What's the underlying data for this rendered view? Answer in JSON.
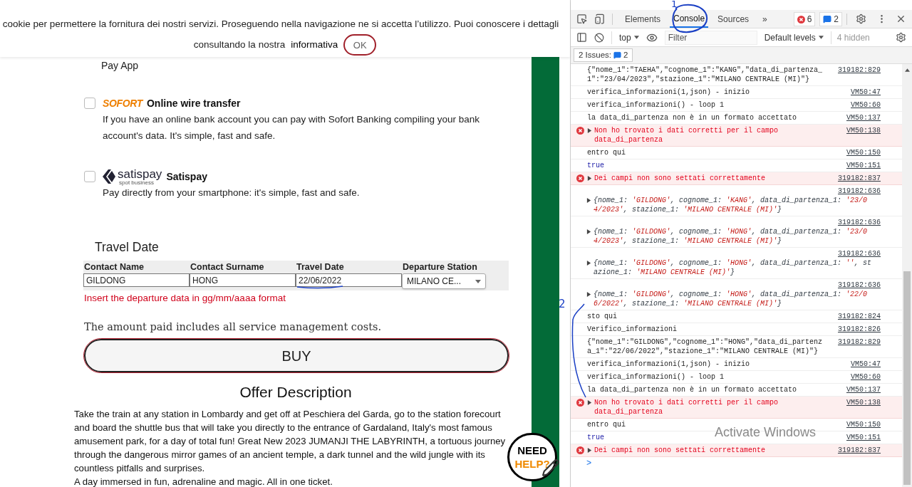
{
  "cookie_banner": {
    "text": "cookie per permettere la fornitura dei nostri servizi. Proseguendo nella navigazione ne si accetta l’utilizzo. Puoi conoscere i dettagli",
    "text_2": "consultando la nostra",
    "link": "informativa",
    "button": "OK"
  },
  "payment": {
    "continued_text": "Pay App",
    "options": [
      {
        "kind": "sofort",
        "logo": "SOFORT",
        "title": "Online wire transfer",
        "description": "If you have an online bank account you can pay with Sofort Banking compiling your bank account's data. It's simple, fast and safe.",
        "checked": false
      },
      {
        "kind": "satispay",
        "logo": "satispay",
        "logo_subtitle": "spot business",
        "title": "Satispay",
        "description": "Pay directly from your smartphone: it's simple, fast and safe.",
        "checked": false
      }
    ]
  },
  "travel_form": {
    "heading": "Travel Date",
    "fields": [
      {
        "kind": "input",
        "label": "Contact Name",
        "value": "GILDONG"
      },
      {
        "kind": "input",
        "label": "Contact Surname",
        "value": "HONG"
      },
      {
        "kind": "input",
        "label": "Travel Date",
        "value": "22/06/2022"
      },
      {
        "kind": "select",
        "label": "Departure Station",
        "value": "MILANO CE..."
      }
    ],
    "error": "Insert the departure data in gg/mm/aaaa format"
  },
  "note": "The amount paid includes all service management costs.",
  "buy_button": "BUY",
  "offer": {
    "heading": "Offer Description",
    "paragraphs": [
      "Take the train at any station in Lombardy and get off at Peschiera del Garda, go to the station forecourt and board the shuttle bus that will take you directly to the entrance of Gardaland, Italy's most famous amusement park, for a day of total fun! Great New 2023 JUMANJI THE LABYRINTH, a tortuous journey through the dangerous mirror games of an ancient temple, a dark tunnel and the wild jungle with its countless pitfalls and surprises.",
      "A day immersed in fun, adrenaline and magic. All in one ticket."
    ]
  },
  "help_badge": {
    "line_1": "NEED",
    "line_2": "HELP?"
  },
  "devtools": {
    "tabs": [
      {
        "label": "Elements",
        "selected": false
      },
      {
        "label": "Console",
        "selected": true
      },
      {
        "label": "Sources",
        "selected": false
      }
    ],
    "more_tabs": "»",
    "error_count": "6",
    "message_count": "2",
    "toolbar": {
      "context": "top",
      "filter_placeholder": "Filter",
      "levels": "Default levels",
      "hidden": "4 hidden"
    },
    "issues": {
      "label": "2 Issues:",
      "count": "2"
    },
    "messages": [
      {
        "kind": "log",
        "text": "{\"nome_1\":\"TAEHA\",\"cognome_1\":\"KANG\",\"data_di_partenza_1\":\"23/04/2023\",\"stazione_1\":\"MILANO CENTRALE (MI)\"}",
        "source": "319182:829"
      },
      {
        "kind": "log",
        "text": "verifica_informazioni(1,json) - inizio",
        "source": "VM50:47"
      },
      {
        "kind": "log",
        "text": "verifica_informazioni() - loop 1",
        "source": "VM50:60"
      },
      {
        "kind": "log",
        "text": "la data_di_partenza non è in un formato accettato",
        "source": "VM50:137"
      },
      {
        "kind": "error",
        "text": "Non ho trovato i dati corretti per il campo data_di_partenza",
        "source": "VM50:138",
        "expanded": false
      },
      {
        "kind": "log",
        "text": "entro qui",
        "source": "VM50:150"
      },
      {
        "kind": "value",
        "text": "true",
        "source": "VM50:151"
      },
      {
        "kind": "error",
        "text": "Dei campi non sono settati correttamente",
        "source": "319182:837",
        "expanded": false
      },
      {
        "kind": "object",
        "source": "319182:636",
        "expanded": false,
        "parts": [
          {
            "kind": "key",
            "text": "{nome_1: "
          },
          {
            "kind": "string",
            "text": "'GILDONG'"
          },
          {
            "kind": "key",
            "text": ", cognome_1: "
          },
          {
            "kind": "string",
            "text": "'KANG'"
          },
          {
            "kind": "key",
            "text": ", data_di_partenza_1: "
          },
          {
            "kind": "string",
            "text": "'23/04/2023'"
          },
          {
            "kind": "key",
            "text": ", stazione_1: "
          },
          {
            "kind": "string",
            "text": "'MILANO CENTRALE (MI)'"
          },
          {
            "kind": "key",
            "text": "}"
          }
        ]
      },
      {
        "kind": "object",
        "source": "319182:636",
        "expanded": false,
        "parts": [
          {
            "kind": "key",
            "text": "{nome_1: "
          },
          {
            "kind": "string",
            "text": "'GILDONG'"
          },
          {
            "kind": "key",
            "text": ", cognome_1: "
          },
          {
            "kind": "string",
            "text": "'HONG'"
          },
          {
            "kind": "key",
            "text": ", data_di_partenza_1: "
          },
          {
            "kind": "string",
            "text": "'23/04/2023'"
          },
          {
            "kind": "key",
            "text": ", stazione_1: "
          },
          {
            "kind": "string",
            "text": "'MILANO CENTRALE (MI)'"
          },
          {
            "kind": "key",
            "text": "}"
          }
        ]
      },
      {
        "kind": "object",
        "source": "319182:636",
        "expanded": false,
        "parts": [
          {
            "kind": "key",
            "text": "{nome_1: "
          },
          {
            "kind": "string",
            "text": "'GILDONG'"
          },
          {
            "kind": "key",
            "text": ", cognome_1: "
          },
          {
            "kind": "string",
            "text": "'HONG'"
          },
          {
            "kind": "key",
            "text": ", data_di_partenza_1: "
          },
          {
            "kind": "string",
            "text": "''"
          },
          {
            "kind": "key",
            "text": ", stazione_1: "
          },
          {
            "kind": "string",
            "text": "'MILANO CENTRALE (MI)'"
          },
          {
            "kind": "key",
            "text": "}"
          }
        ]
      },
      {
        "kind": "object",
        "source": "319182:636",
        "expanded": false,
        "parts": [
          {
            "kind": "key",
            "text": "{nome_1: "
          },
          {
            "kind": "string",
            "text": "'GILDONG'"
          },
          {
            "kind": "key",
            "text": ", cognome_1: "
          },
          {
            "kind": "string",
            "text": "'HONG'"
          },
          {
            "kind": "key",
            "text": ", data_di_partenza_1: "
          },
          {
            "kind": "string",
            "text": "'22/06/2022'"
          },
          {
            "kind": "key",
            "text": ", stazione_1: "
          },
          {
            "kind": "string",
            "text": "'MILANO CENTRALE (MI)'"
          },
          {
            "kind": "key",
            "text": "}"
          }
        ]
      },
      {
        "kind": "log",
        "text": "sto qui",
        "source": "319182:824"
      },
      {
        "kind": "log",
        "text": "Verifico_informazioni",
        "source": "319182:826"
      },
      {
        "kind": "log",
        "text": "{\"nome_1\":\"GILDONG\",\"cognome_1\":\"HONG\",\"data_di_partenza_1\":\"22/06/2022\",\"stazione_1\":\"MILANO CENTRALE (MI)\"}",
        "source": "319182:829"
      },
      {
        "kind": "log",
        "text": "verifica_informazioni(1,json) - inizio",
        "source": "VM50:47"
      },
      {
        "kind": "log",
        "text": "verifica_informazioni() - loop 1",
        "source": "VM50:60"
      },
      {
        "kind": "log",
        "text": "la data_di_partenza non è in un formato accettato",
        "source": "VM50:137"
      },
      {
        "kind": "error",
        "text": "Non ho trovato i dati corretti per il campo data_di_partenza",
        "source": "VM50:138",
        "expanded": false
      },
      {
        "kind": "log",
        "text": "entro qui",
        "source": "VM50:150"
      },
      {
        "kind": "value",
        "text": "true",
        "source": "VM50:151"
      },
      {
        "kind": "error",
        "text": "Dei campi non sono settati correttamente",
        "source": "319182:837",
        "expanded": false
      }
    ],
    "prompt": ">"
  },
  "annotations": {
    "mark_1": "1",
    "mark_2": "2"
  },
  "os_watermark": "Activate Windows"
}
